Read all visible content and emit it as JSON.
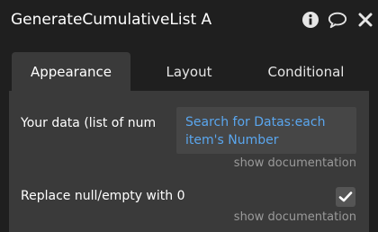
{
  "header": {
    "title": "GenerateCumulativeList A",
    "icons": [
      "info-icon",
      "comment-icon",
      "close-icon"
    ]
  },
  "tabs": [
    {
      "label": "Appearance",
      "active": true
    },
    {
      "label": "Layout",
      "active": false
    },
    {
      "label": "Conditional",
      "active": false
    }
  ],
  "fields": {
    "data": {
      "label": "Your data (list of num",
      "value_line1": "Search for Datas:each",
      "value_line2": "item's Number",
      "doc_link": "show documentation"
    },
    "replace_null": {
      "label": "Replace null/empty with 0",
      "checked": true,
      "doc_link": "show documentation"
    }
  },
  "colors": {
    "background": "#1f1f1f",
    "panel": "#3a3a3a",
    "field": "#464646",
    "link": "#5aa6ee",
    "muted": "#9a9a9a"
  }
}
